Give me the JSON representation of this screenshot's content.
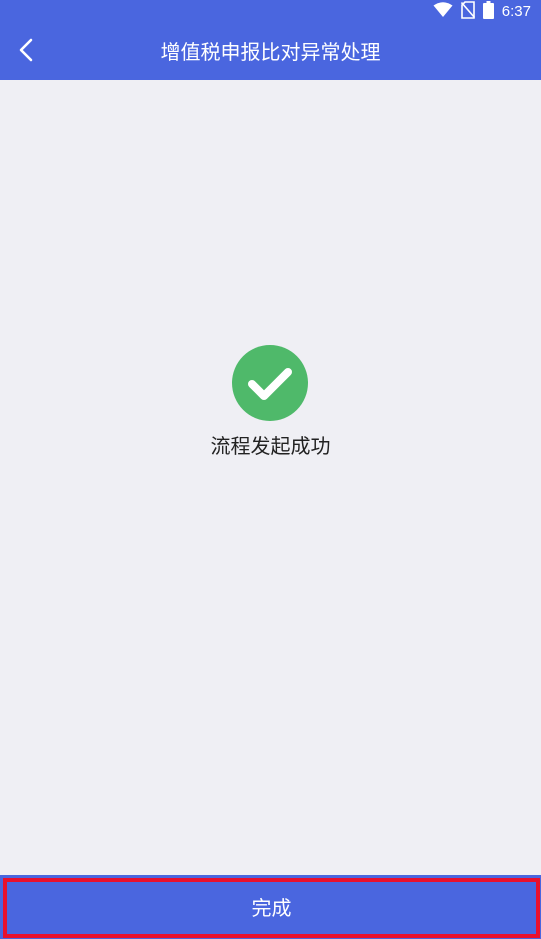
{
  "status_bar": {
    "time": "6:37",
    "icons": [
      "wifi-icon",
      "no-sim-icon",
      "battery-icon"
    ]
  },
  "header": {
    "back_icon": "chevron-left-icon",
    "title": "增值税申报比对异常处理"
  },
  "main": {
    "result_icon": "check-circle-icon",
    "message": "流程发起成功"
  },
  "footer": {
    "done_label": "完成"
  },
  "colors": {
    "primary": "#4a66df",
    "background": "#efeff4",
    "success": "#4fb96a",
    "highlight_border": "#e8102e"
  }
}
